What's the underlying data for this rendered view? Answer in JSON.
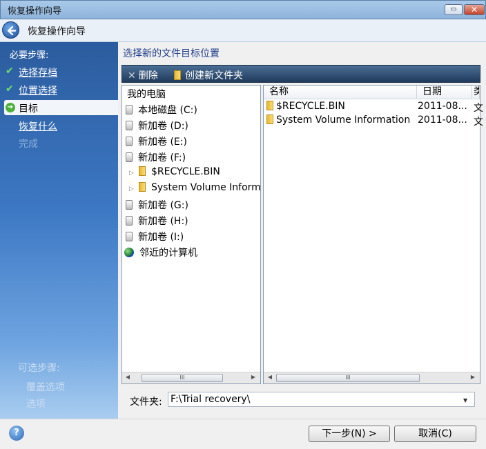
{
  "window": {
    "title": "恢复操作向导",
    "max_glyph": "▭",
    "close_glyph": "✕"
  },
  "header": {
    "title": "恢复操作向导",
    "back_icon": "back-arrow-icon"
  },
  "sidebar": {
    "required_heading": "必要步骤:",
    "items": [
      {
        "label": "选择存档",
        "state": "done",
        "mark": "✔"
      },
      {
        "label": "位置选择",
        "state": "done",
        "mark": "✔"
      },
      {
        "label": "目标",
        "state": "active",
        "mark": "➔"
      },
      {
        "label": "恢复什么",
        "state": "pending"
      },
      {
        "label": "完成",
        "state": "disabled"
      }
    ],
    "optional_heading": "可选步骤:",
    "optional_items": [
      "覆盖选项",
      "选项"
    ]
  },
  "main": {
    "title": "选择新的文件目标位置",
    "toolbar": {
      "delete_label": "删除",
      "delete_glyph": "✕",
      "new_folder_label": "创建新文件夹"
    },
    "tree": {
      "root": "我的电脑",
      "nodes": [
        {
          "label": "本地磁盘 (C:)",
          "icon": "drive-icon"
        },
        {
          "label": "新加卷 (D:)",
          "icon": "drive-icon"
        },
        {
          "label": "新加卷 (E:)",
          "icon": "drive-icon"
        },
        {
          "label": "新加卷 (F:)",
          "icon": "drive-icon"
        },
        {
          "label": "$RECYCLE.BIN",
          "icon": "folder-icon",
          "child": true
        },
        {
          "label": "System Volume Information",
          "icon": "folder-icon",
          "child": true
        },
        {
          "label": "新加卷 (G:)",
          "icon": "drive-icon"
        },
        {
          "label": "新加卷 (H:)",
          "icon": "drive-icon"
        },
        {
          "label": "新加卷 (I:)",
          "icon": "drive-icon"
        },
        {
          "label": "邻近的计算机",
          "icon": "network-globe-icon"
        }
      ]
    },
    "file_list": {
      "columns": [
        "名称",
        "日期",
        "类"
      ],
      "rows": [
        {
          "name": "$RECYCLE.BIN",
          "date": "2011-08...",
          "type": "文"
        },
        {
          "name": "System Volume Information",
          "date": "2011-08...",
          "type": "文"
        }
      ]
    },
    "scroll": {
      "left_arrow": "◀",
      "right_arrow": "▶",
      "grip": "III"
    },
    "folder_field": {
      "label": "文件夹:",
      "value": "F:\\Trial recovery\\",
      "dropdown_glyph": "▼"
    }
  },
  "footer": {
    "help_glyph": "?",
    "next_label": "下一步(N) >",
    "cancel_label": "取消(C)"
  }
}
